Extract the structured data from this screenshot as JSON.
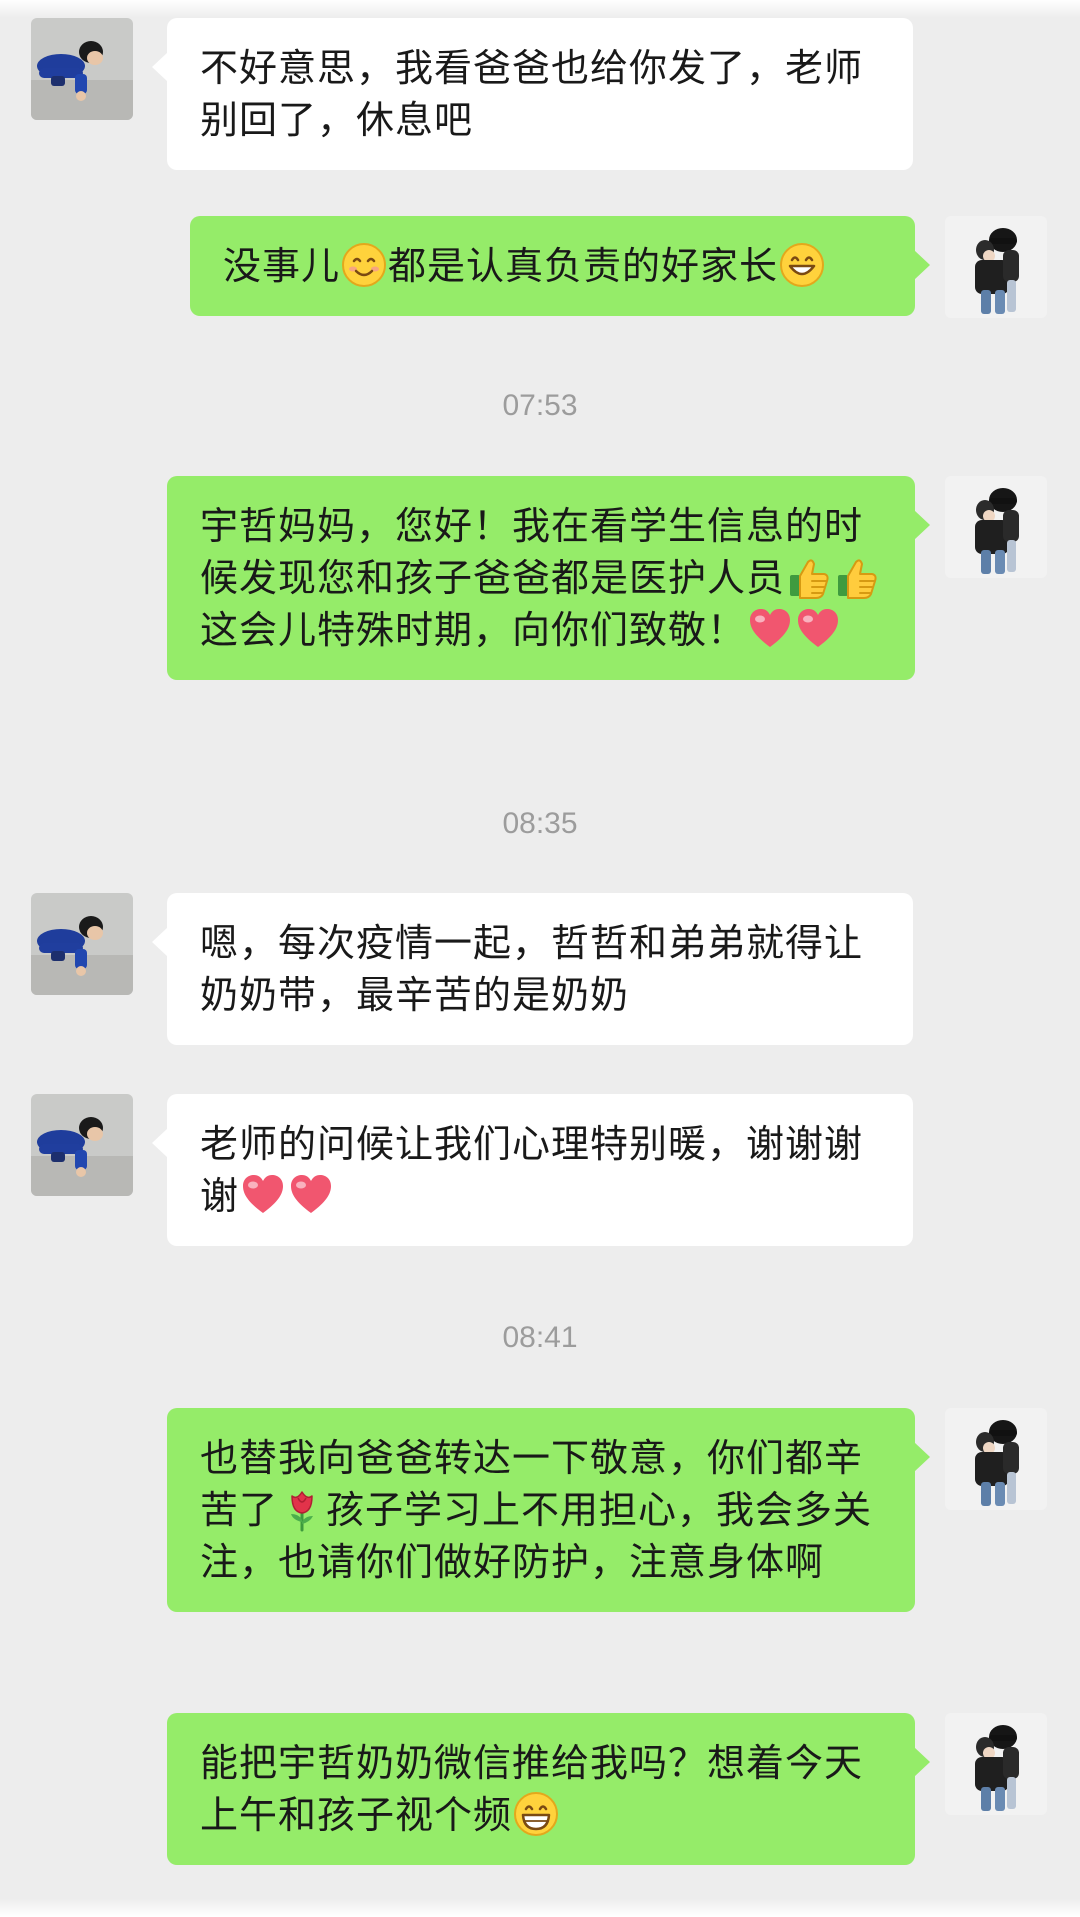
{
  "timestamps": [
    "07:53",
    "08:35",
    "08:41"
  ],
  "messages": {
    "m1": {
      "sender": "parent",
      "text": "不好意思，我看爸爸也给你发了，老师别回了，休息吧"
    },
    "m2": {
      "sender": "teacher",
      "part1": "没事儿",
      "emoji1": "smiling-face-icon",
      "part2": "都是认真负责的好家长",
      "emoji2": "grinning-face-icon"
    },
    "m3": {
      "sender": "teacher",
      "part1": "宇哲妈妈，您好！我在看学生信息的时候发现您和孩子爸爸都是医护人员",
      "emoji1": "thumbs-up-icon",
      "emoji2": "thumbs-up-icon",
      "part2": "这会儿特殊时期，向你们致敬！",
      "emoji3": "heart-icon",
      "emoji4": "heart-icon"
    },
    "m4": {
      "sender": "parent",
      "text": "嗯，每次疫情一起，哲哲和弟弟就得让奶奶带，最辛苦的是奶奶"
    },
    "m5": {
      "sender": "parent",
      "part1": "老师的问候让我们心理特别暖，谢谢谢谢",
      "emoji1": "heart-icon",
      "emoji2": "heart-icon"
    },
    "m6": {
      "sender": "teacher",
      "part1": "也替我向爸爸转达一下敬意，你们都辛苦了",
      "emoji1": "rose-icon",
      "part2": "孩子学习上不用担心，我会多关注，也请你们做好防护，注意身体啊"
    },
    "m7": {
      "sender": "teacher",
      "part1": "能把宇哲奶奶微信推给我吗？想着今天上午和孩子视个频",
      "emoji1": "grinning-face-icon"
    }
  },
  "colors": {
    "background": "#ededed",
    "sent_bubble": "#95ec69",
    "received_bubble": "#ffffff",
    "timestamp_text": "#9c9c9c",
    "message_text": "#191919"
  },
  "avatars": {
    "parent": "child-in-blue-jacket-photo",
    "teacher": "two-people-hugging-photo"
  }
}
